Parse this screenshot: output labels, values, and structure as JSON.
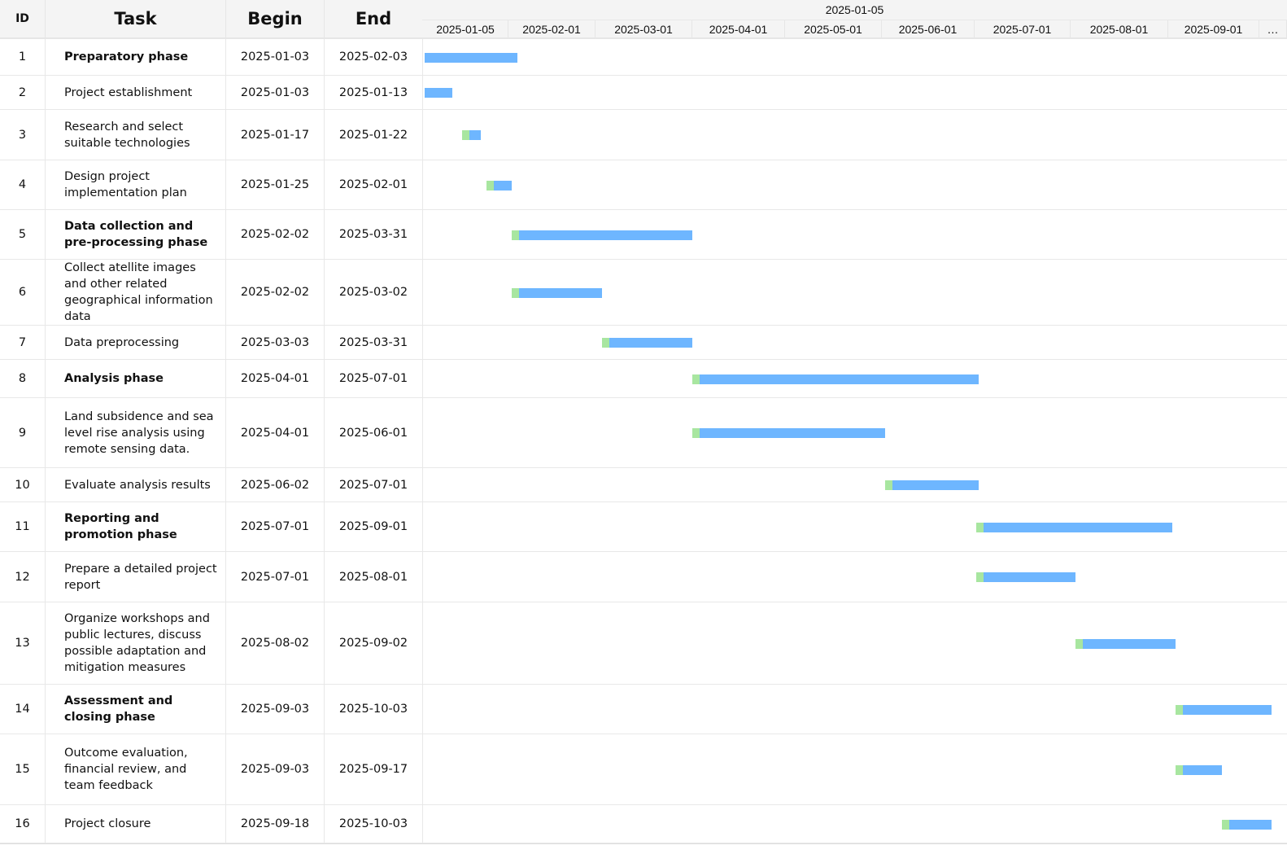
{
  "columns": {
    "id": "ID",
    "task": "Task",
    "begin": "Begin",
    "end": "End"
  },
  "timeline": {
    "top_label": "2025-01-05",
    "months": [
      "2025-01-05",
      "2025-02-01",
      "2025-03-01",
      "2025-04-01",
      "2025-05-01",
      "2025-06-01",
      "2025-07-01",
      "2025-08-01",
      "2025-09-01",
      "…"
    ]
  },
  "colors": {
    "bar": "#6eb6ff",
    "progress": "#a8e6a0",
    "header_bg": "#f4f4f4"
  },
  "tasks": [
    {
      "id": "1",
      "name": "Preparatory phase",
      "begin": "2025-01-03",
      "end": "2025-02-03",
      "bold": true
    },
    {
      "id": "2",
      "name": "Project establishment",
      "begin": "2025-01-03",
      "end": "2025-01-13",
      "bold": false
    },
    {
      "id": "3",
      "name": "Research and select suitable technologies",
      "begin": "2025-01-17",
      "end": "2025-01-22",
      "bold": false
    },
    {
      "id": "4",
      "name": "Design project implementation plan",
      "begin": "2025-01-25",
      "end": "2025-02-01",
      "bold": false
    },
    {
      "id": "5",
      "name": "Data collection and pre-processing phase",
      "begin": "2025-02-02",
      "end": "2025-03-31",
      "bold": true
    },
    {
      "id": "6",
      "name": "Collect atellite images and other related geographical information data",
      "begin": "2025-02-02",
      "end": "2025-03-02",
      "bold": false
    },
    {
      "id": "7",
      "name": "Data preprocessing",
      "begin": "2025-03-03",
      "end": "2025-03-31",
      "bold": false
    },
    {
      "id": "8",
      "name": "Analysis phase",
      "begin": "2025-04-01",
      "end": "2025-07-01",
      "bold": true
    },
    {
      "id": "9",
      "name": "Land subsidence and sea level rise analysis using remote sensing data.",
      "begin": "2025-04-01",
      "end": "2025-06-01",
      "bold": false
    },
    {
      "id": "10",
      "name": "Evaluate analysis results",
      "begin": "2025-06-02",
      "end": "2025-07-01",
      "bold": false
    },
    {
      "id": "11",
      "name": "Reporting and promotion phase",
      "begin": "2025-07-01",
      "end": "2025-09-01",
      "bold": true
    },
    {
      "id": "12",
      "name": "Prepare a detailed project report",
      "begin": "2025-07-01",
      "end": "2025-08-01",
      "bold": false
    },
    {
      "id": "13",
      "name": "Organize workshops and public lectures, discuss possible adaptation and mitigation measures",
      "begin": "2025-08-02",
      "end": "2025-09-02",
      "bold": false
    },
    {
      "id": "14",
      "name": "Assessment and closing phase",
      "begin": "2025-09-03",
      "end": "2025-10-03",
      "bold": true
    },
    {
      "id": "15",
      "name": "Outcome evaluation, financial review, and team feedback",
      "begin": "2025-09-03",
      "end": "2025-09-17",
      "bold": false
    },
    {
      "id": "16",
      "name": "Project closure",
      "begin": "2025-09-18",
      "end": "2025-10-03",
      "bold": false
    }
  ]
}
